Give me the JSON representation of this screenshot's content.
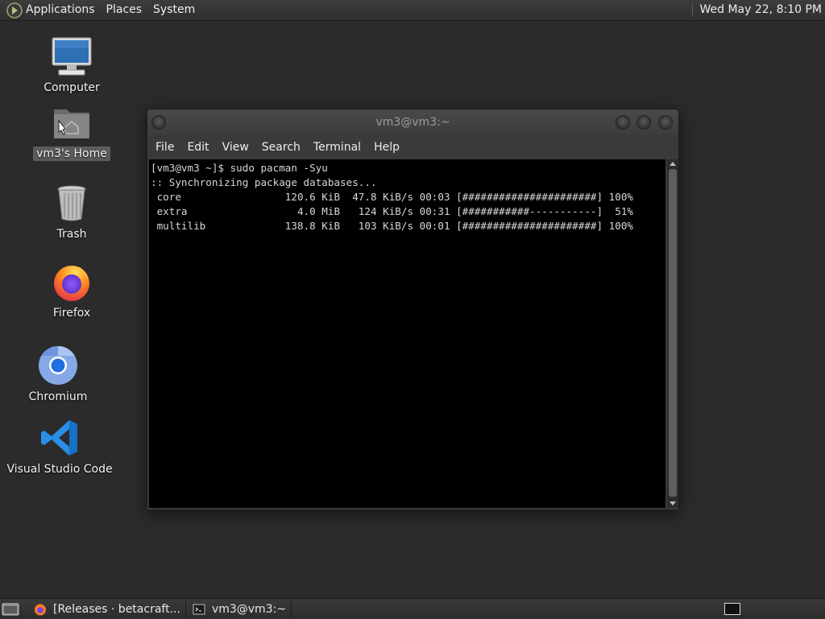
{
  "top_panel": {
    "menus": [
      "Applications",
      "Places",
      "System"
    ],
    "clock": "Wed May 22,  8:10 PM",
    "icons": {
      "apps": "gnome-foot-icon"
    }
  },
  "desktop": {
    "icons": [
      {
        "label": "Computer",
        "icon": "monitor-icon"
      },
      {
        "label": "vm3's Home",
        "icon": "home-folder-icon",
        "selected": true
      },
      {
        "label": "Trash",
        "icon": "trash-icon"
      },
      {
        "label": "Firefox",
        "icon": "firefox-icon"
      },
      {
        "label": "Chromium",
        "icon": "chromium-icon"
      },
      {
        "label": "Visual Studio Code",
        "icon": "vscode-icon"
      }
    ]
  },
  "terminal_window": {
    "title": "vm3@vm3:~",
    "menu": [
      "File",
      "Edit",
      "View",
      "Search",
      "Terminal",
      "Help"
    ],
    "lines": [
      "[vm3@vm3 ~]$ sudo pacman -Syu",
      ":: Synchronizing package databases...",
      " core                 120.6 KiB  47.8 KiB/s 00:03 [######################] 100%",
      " extra                  4.0 MiB   124 KiB/s 00:31 [###########-----------]  51%",
      " multilib             138.8 KiB   103 KiB/s 00:01 [######################] 100%"
    ],
    "sync": [
      {
        "repo": "core",
        "size": "120.6 KiB",
        "rate": "47.8 KiB/s",
        "time": "00:03",
        "progress": 100
      },
      {
        "repo": "extra",
        "size": "4.0 MiB",
        "rate": "124 KiB/s",
        "time": "00:31",
        "progress": 51
      },
      {
        "repo": "multilib",
        "size": "138.8 KiB",
        "rate": "103 KiB/s",
        "time": "00:01",
        "progress": 100
      }
    ]
  },
  "bottom_panel": {
    "tasks": [
      {
        "label": "[Releases · betacraft...",
        "icon": "firefox-icon"
      },
      {
        "label": "vm3@vm3:~",
        "icon": "terminal-icon"
      }
    ]
  },
  "colors": {
    "desktop": "#2b2b2b",
    "panel": "#353535",
    "terminal_bg": "#000000",
    "terminal_fg": "#d7d7d7"
  }
}
